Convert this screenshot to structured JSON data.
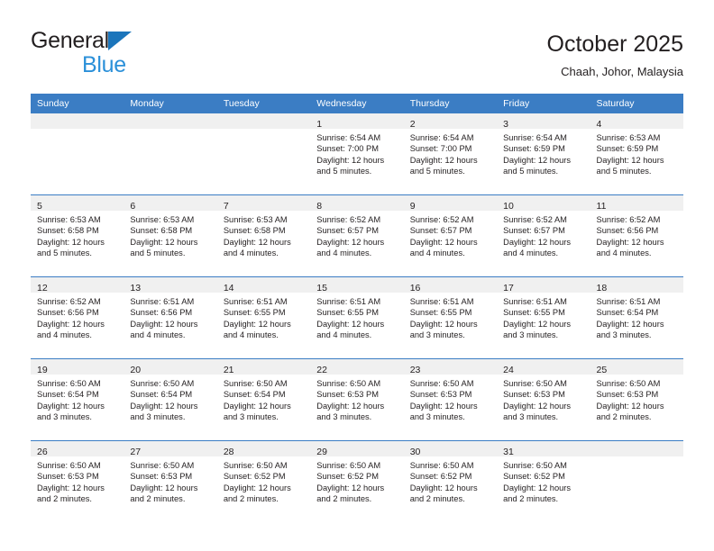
{
  "brand": {
    "name_part1": "General",
    "name_part2": "Blue",
    "triangle_color": "#1b75bb",
    "blue_text_color": "#2b90d9"
  },
  "header": {
    "title": "October 2025",
    "subtitle": "Chaah, Johor, Malaysia"
  },
  "colors": {
    "header_row_background": "#3b7dc4",
    "header_row_text": "#ffffff",
    "daynumber_band": "#f0f0f0",
    "cell_text": "#231f20",
    "week_divider": "#3b7dc4"
  },
  "weekday_headers": [
    "Sunday",
    "Monday",
    "Tuesday",
    "Wednesday",
    "Thursday",
    "Friday",
    "Saturday"
  ],
  "weeks": [
    [
      {
        "day": "",
        "empty": true,
        "lines": []
      },
      {
        "day": "",
        "empty": true,
        "lines": []
      },
      {
        "day": "",
        "empty": true,
        "lines": []
      },
      {
        "day": "1",
        "empty": false,
        "lines": [
          "Sunrise: 6:54 AM",
          "Sunset: 7:00 PM",
          "Daylight: 12 hours",
          "and 5 minutes."
        ]
      },
      {
        "day": "2",
        "empty": false,
        "lines": [
          "Sunrise: 6:54 AM",
          "Sunset: 7:00 PM",
          "Daylight: 12 hours",
          "and 5 minutes."
        ]
      },
      {
        "day": "3",
        "empty": false,
        "lines": [
          "Sunrise: 6:54 AM",
          "Sunset: 6:59 PM",
          "Daylight: 12 hours",
          "and 5 minutes."
        ]
      },
      {
        "day": "4",
        "empty": false,
        "lines": [
          "Sunrise: 6:53 AM",
          "Sunset: 6:59 PM",
          "Daylight: 12 hours",
          "and 5 minutes."
        ]
      }
    ],
    [
      {
        "day": "5",
        "empty": false,
        "lines": [
          "Sunrise: 6:53 AM",
          "Sunset: 6:58 PM",
          "Daylight: 12 hours",
          "and 5 minutes."
        ]
      },
      {
        "day": "6",
        "empty": false,
        "lines": [
          "Sunrise: 6:53 AM",
          "Sunset: 6:58 PM",
          "Daylight: 12 hours",
          "and 5 minutes."
        ]
      },
      {
        "day": "7",
        "empty": false,
        "lines": [
          "Sunrise: 6:53 AM",
          "Sunset: 6:58 PM",
          "Daylight: 12 hours",
          "and 4 minutes."
        ]
      },
      {
        "day": "8",
        "empty": false,
        "lines": [
          "Sunrise: 6:52 AM",
          "Sunset: 6:57 PM",
          "Daylight: 12 hours",
          "and 4 minutes."
        ]
      },
      {
        "day": "9",
        "empty": false,
        "lines": [
          "Sunrise: 6:52 AM",
          "Sunset: 6:57 PM",
          "Daylight: 12 hours",
          "and 4 minutes."
        ]
      },
      {
        "day": "10",
        "empty": false,
        "lines": [
          "Sunrise: 6:52 AM",
          "Sunset: 6:57 PM",
          "Daylight: 12 hours",
          "and 4 minutes."
        ]
      },
      {
        "day": "11",
        "empty": false,
        "lines": [
          "Sunrise: 6:52 AM",
          "Sunset: 6:56 PM",
          "Daylight: 12 hours",
          "and 4 minutes."
        ]
      }
    ],
    [
      {
        "day": "12",
        "empty": false,
        "lines": [
          "Sunrise: 6:52 AM",
          "Sunset: 6:56 PM",
          "Daylight: 12 hours",
          "and 4 minutes."
        ]
      },
      {
        "day": "13",
        "empty": false,
        "lines": [
          "Sunrise: 6:51 AM",
          "Sunset: 6:56 PM",
          "Daylight: 12 hours",
          "and 4 minutes."
        ]
      },
      {
        "day": "14",
        "empty": false,
        "lines": [
          "Sunrise: 6:51 AM",
          "Sunset: 6:55 PM",
          "Daylight: 12 hours",
          "and 4 minutes."
        ]
      },
      {
        "day": "15",
        "empty": false,
        "lines": [
          "Sunrise: 6:51 AM",
          "Sunset: 6:55 PM",
          "Daylight: 12 hours",
          "and 4 minutes."
        ]
      },
      {
        "day": "16",
        "empty": false,
        "lines": [
          "Sunrise: 6:51 AM",
          "Sunset: 6:55 PM",
          "Daylight: 12 hours",
          "and 3 minutes."
        ]
      },
      {
        "day": "17",
        "empty": false,
        "lines": [
          "Sunrise: 6:51 AM",
          "Sunset: 6:55 PM",
          "Daylight: 12 hours",
          "and 3 minutes."
        ]
      },
      {
        "day": "18",
        "empty": false,
        "lines": [
          "Sunrise: 6:51 AM",
          "Sunset: 6:54 PM",
          "Daylight: 12 hours",
          "and 3 minutes."
        ]
      }
    ],
    [
      {
        "day": "19",
        "empty": false,
        "lines": [
          "Sunrise: 6:50 AM",
          "Sunset: 6:54 PM",
          "Daylight: 12 hours",
          "and 3 minutes."
        ]
      },
      {
        "day": "20",
        "empty": false,
        "lines": [
          "Sunrise: 6:50 AM",
          "Sunset: 6:54 PM",
          "Daylight: 12 hours",
          "and 3 minutes."
        ]
      },
      {
        "day": "21",
        "empty": false,
        "lines": [
          "Sunrise: 6:50 AM",
          "Sunset: 6:54 PM",
          "Daylight: 12 hours",
          "and 3 minutes."
        ]
      },
      {
        "day": "22",
        "empty": false,
        "lines": [
          "Sunrise: 6:50 AM",
          "Sunset: 6:53 PM",
          "Daylight: 12 hours",
          "and 3 minutes."
        ]
      },
      {
        "day": "23",
        "empty": false,
        "lines": [
          "Sunrise: 6:50 AM",
          "Sunset: 6:53 PM",
          "Daylight: 12 hours",
          "and 3 minutes."
        ]
      },
      {
        "day": "24",
        "empty": false,
        "lines": [
          "Sunrise: 6:50 AM",
          "Sunset: 6:53 PM",
          "Daylight: 12 hours",
          "and 3 minutes."
        ]
      },
      {
        "day": "25",
        "empty": false,
        "lines": [
          "Sunrise: 6:50 AM",
          "Sunset: 6:53 PM",
          "Daylight: 12 hours",
          "and 2 minutes."
        ]
      }
    ],
    [
      {
        "day": "26",
        "empty": false,
        "lines": [
          "Sunrise: 6:50 AM",
          "Sunset: 6:53 PM",
          "Daylight: 12 hours",
          "and 2 minutes."
        ]
      },
      {
        "day": "27",
        "empty": false,
        "lines": [
          "Sunrise: 6:50 AM",
          "Sunset: 6:53 PM",
          "Daylight: 12 hours",
          "and 2 minutes."
        ]
      },
      {
        "day": "28",
        "empty": false,
        "lines": [
          "Sunrise: 6:50 AM",
          "Sunset: 6:52 PM",
          "Daylight: 12 hours",
          "and 2 minutes."
        ]
      },
      {
        "day": "29",
        "empty": false,
        "lines": [
          "Sunrise: 6:50 AM",
          "Sunset: 6:52 PM",
          "Daylight: 12 hours",
          "and 2 minutes."
        ]
      },
      {
        "day": "30",
        "empty": false,
        "lines": [
          "Sunrise: 6:50 AM",
          "Sunset: 6:52 PM",
          "Daylight: 12 hours",
          "and 2 minutes."
        ]
      },
      {
        "day": "31",
        "empty": false,
        "lines": [
          "Sunrise: 6:50 AM",
          "Sunset: 6:52 PM",
          "Daylight: 12 hours",
          "and 2 minutes."
        ]
      },
      {
        "day": "",
        "empty": true,
        "lines": []
      }
    ]
  ]
}
